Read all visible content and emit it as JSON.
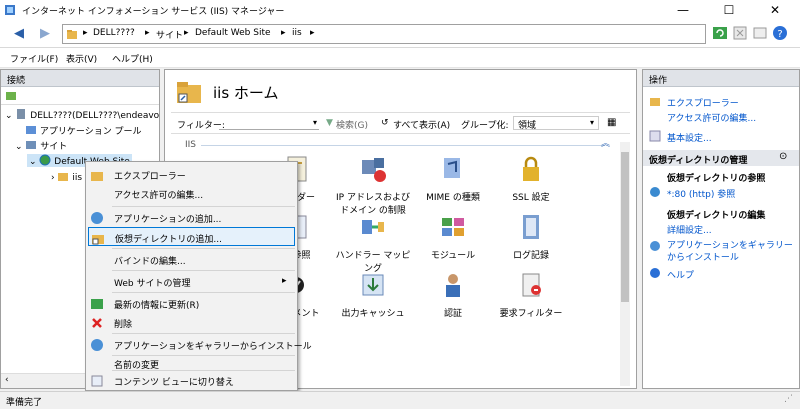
{
  "window": {
    "title": "インターネット インフォメーション サービス (IIS) マネージャー",
    "minimize": "—",
    "maximize": "☐",
    "close": "✕"
  },
  "address": {
    "crumbs": [
      "DELL????",
      "サイト",
      "Default Web Site",
      "iis"
    ],
    "separator": "▸"
  },
  "menu": {
    "file": "ファイル(F)",
    "view": "表示(V)",
    "help": "ヘルプ(H)"
  },
  "left": {
    "header": "接続",
    "tree": {
      "server": "DELL????(DELL????\\endeavo",
      "app_pools": "アプリケーション プール",
      "sites": "サイト",
      "default_site": "Default Web Site",
      "iis_node": "iis"
    }
  },
  "center": {
    "title": "iis ホーム",
    "filter_label": "フィルター:",
    "search_label": "検索(G)",
    "show_all_label": "すべて表示(A)",
    "group_label": "グループ化:",
    "group_value": "領域",
    "section_label": "IIS",
    "features": [
      "ヘッダー",
      "IP アドレスおよびドメイン の制限",
      "MIME の種類",
      "SSL 設定",
      "の参照",
      "ハンドラー マッピング",
      "モジュール",
      "ログ記録",
      "キュメント",
      "出力キャッシュ",
      "認証",
      "要求フィルター"
    ]
  },
  "right": {
    "header": "操作",
    "explore": "エクスプローラー",
    "edit_permissions": "アクセス許可の編集...",
    "basic_settings": "基本設定...",
    "vdir_header": "仮想ディレクトリの管理",
    "browse_vdir": "仮想ディレクトリの参照",
    "browse_link": "*:80 (http) 参照",
    "edit_vdir": "仮想ディレクトリの編集",
    "advanced_settings": "詳細設定...",
    "install_from_gallery": "アプリケーションをギャラリーからインストール",
    "help": "ヘルプ"
  },
  "context_menu": {
    "items": [
      "エクスプローラー",
      "アクセス許可の編集...",
      "アプリケーションの追加...",
      "仮想ディレクトリの追加...",
      "バインドの編集...",
      "Web サイトの管理",
      "最新の情報に更新(R)",
      "削除",
      "アプリケーションをギャラリーからインストール",
      "名前の変更",
      "コンテンツ ビューに切り替え"
    ],
    "submenu_arrow": "▸"
  },
  "status": {
    "text": "準備完了"
  },
  "colors": {
    "link": "#0055cc",
    "highlight": "#0078d7",
    "header_bg": "#e0e3e8"
  }
}
